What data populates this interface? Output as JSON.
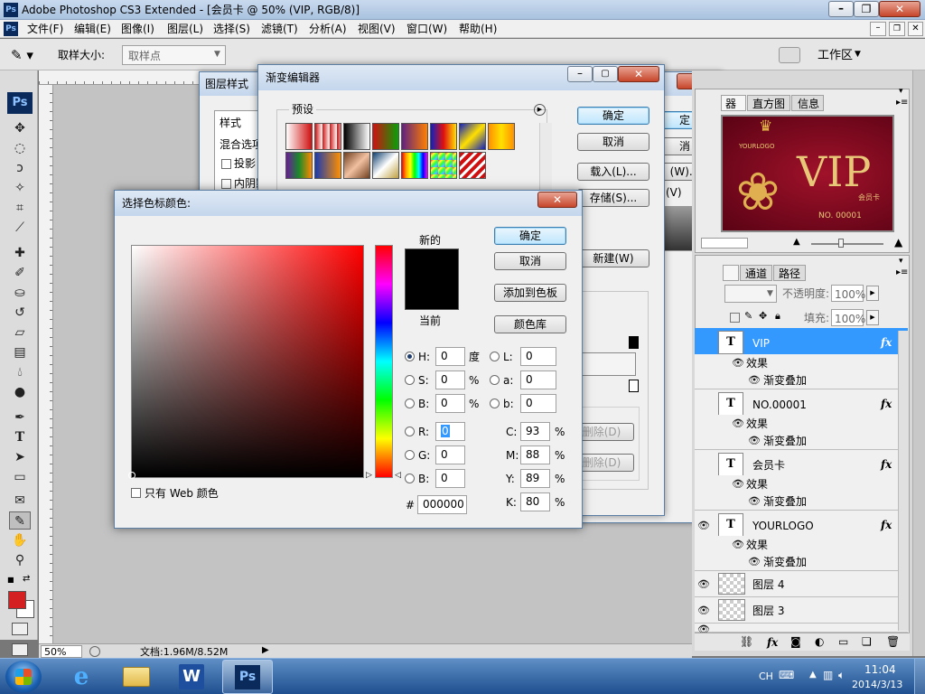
{
  "app": {
    "title": "Adobe Photoshop CS3 Extended - [会员卡 @ 50% (VIP, RGB/8)]"
  },
  "menu": [
    "文件(F)",
    "编辑(E)",
    "图像(I)",
    "图层(L)",
    "选择(S)",
    "滤镜(T)",
    "分析(A)",
    "视图(V)",
    "窗口(W)",
    "帮助(H)"
  ],
  "options_bar": {
    "sample_size_label": "取样大小:",
    "sample_size_value": "取样点",
    "workspace_label": "工作区"
  },
  "status_bar": {
    "zoom": "50%",
    "doc_info": "文档:1.96M/8.52M"
  },
  "layer_style_dialog": {
    "title": "图层样式",
    "style_header": "样式",
    "blend_options": "混合选项",
    "drop_shadow": "投影",
    "inner_shadow": "内阴影"
  },
  "gradient_editor": {
    "title": "渐变编辑器",
    "presets_label": "预设",
    "ok": "确定",
    "cancel": "取消",
    "load": "载入(L)...",
    "save": "存储(S)...",
    "new": "新建(W)",
    "delete_1": "删除(D)",
    "delete_2": "删除(D)"
  },
  "behind_dialog": {
    "ok_partial": "定",
    "cancel_partial": "消",
    "new_partial": "(W)...",
    "w_partial": "(V)"
  },
  "color_picker": {
    "title": "选择色标颜色:",
    "new_label": "新的",
    "current_label": "当前",
    "ok": "确定",
    "cancel": "取消",
    "add_swatch": "添加到色板",
    "color_libraries": "颜色库",
    "web_only": "只有 Web 颜色",
    "H": "0",
    "S": "0",
    "B": "0",
    "R": "0",
    "G": "0",
    "Bv": "0",
    "L": "0",
    "a": "0",
    "b": "0",
    "C": "93",
    "M": "88",
    "Y": "89",
    "K": "80",
    "hex": "000000",
    "unit_deg": "度",
    "unit_pct": "%",
    "field_labels": {
      "H": "H:",
      "S": "S:",
      "B": "B:",
      "R": "R:",
      "G": "G:",
      "Bb": "B:",
      "L": "L:",
      "a": "a:",
      "b": "b:",
      "C": "C:",
      "M": "M:",
      "Y": "Y:",
      "K": "K:",
      "hash": "#"
    }
  },
  "navigator_panel": {
    "tabs": [
      "器",
      "直方图",
      "信息"
    ],
    "preview": {
      "logo": "YOURLOGO",
      "vip": "VIP",
      "card": "会员卡",
      "number": "NO. 00001"
    }
  },
  "layers_panel": {
    "tabs": [
      "通道",
      "路径"
    ],
    "opacity_label": "不透明度:",
    "opacity_value": "100%",
    "fill_label": "填充:",
    "fill_value": "100%",
    "effects_label": "效果",
    "gradient_overlay_label": "渐变叠加",
    "layers": [
      {
        "name": "VIP",
        "type": "text",
        "selected": true
      },
      {
        "name": "NO.00001",
        "type": "text"
      },
      {
        "name": "会员卡",
        "type": "text"
      },
      {
        "name": "YOURLOGO",
        "type": "text"
      },
      {
        "name": "图层 4",
        "type": "pixel"
      },
      {
        "name": "图层 3",
        "type": "pixel"
      }
    ]
  },
  "taskbar": {
    "lang": "CH",
    "time": "11:04",
    "date": "2014/3/13"
  },
  "colors": {
    "foreground": "#d42020",
    "background": "#ffffff",
    "selection": "#3399ff",
    "accent": "#cfe0f5"
  }
}
